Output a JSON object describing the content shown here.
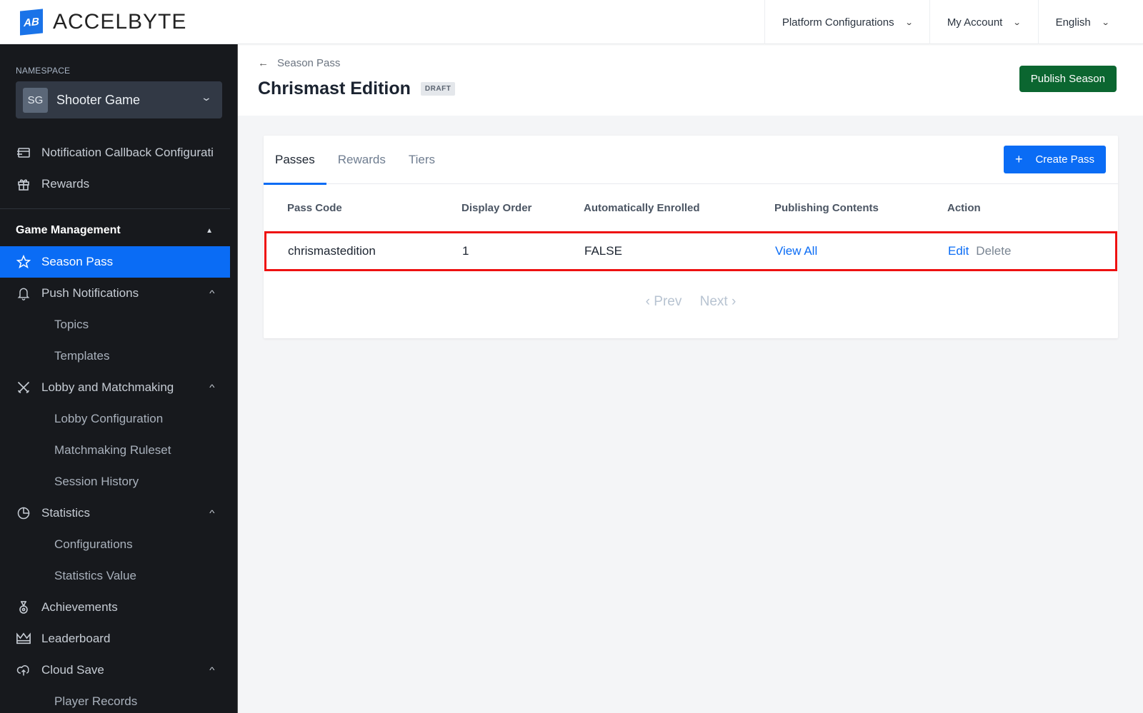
{
  "app": {
    "logo_mark": "AB",
    "logo_text": "ACCELBYTE"
  },
  "topbar": {
    "menus": [
      {
        "label": "Platform Configurations"
      },
      {
        "label": "My Account"
      },
      {
        "label": "English"
      }
    ]
  },
  "sidebar": {
    "namespace_label": "NAMESPACE",
    "namespace_avatar": "SG",
    "namespace_name": "Shooter Game",
    "items_top": [
      {
        "label": "Notification Callback Configurati",
        "icon": "callback-icon"
      },
      {
        "label": "Rewards",
        "icon": "gift-icon"
      }
    ],
    "group_label": "Game Management",
    "items": [
      {
        "label": "Season Pass",
        "icon": "star-icon",
        "active": true
      },
      {
        "label": "Push Notifications",
        "icon": "bell-icon",
        "expanded": true
      },
      {
        "label": "Topics",
        "sub": true
      },
      {
        "label": "Templates",
        "sub": true
      },
      {
        "label": "Lobby and Matchmaking",
        "icon": "swords-icon",
        "expanded": true
      },
      {
        "label": "Lobby Configuration",
        "sub": true
      },
      {
        "label": "Matchmaking Ruleset",
        "sub": true
      },
      {
        "label": "Session History",
        "sub": true
      },
      {
        "label": "Statistics",
        "icon": "pie-chart-icon",
        "expanded": true
      },
      {
        "label": "Configurations",
        "sub": true
      },
      {
        "label": "Statistics Value",
        "sub": true
      },
      {
        "label": "Achievements",
        "icon": "medal-icon"
      },
      {
        "label": "Leaderboard",
        "icon": "crown-icon"
      },
      {
        "label": "Cloud Save",
        "icon": "cloud-upload-icon",
        "expanded": true
      },
      {
        "label": "Player Records",
        "sub": true
      }
    ]
  },
  "page": {
    "breadcrumb_back": "Season Pass",
    "title": "Chrismast Edition",
    "status_badge": "DRAFT",
    "publish_button": "Publish Season"
  },
  "tabs": [
    {
      "label": "Passes",
      "active": true
    },
    {
      "label": "Rewards"
    },
    {
      "label": "Tiers"
    }
  ],
  "create_button": "Create Pass",
  "table": {
    "columns": [
      "Pass Code",
      "Display Order",
      "Automatically Enrolled",
      "Publishing Contents",
      "Action"
    ],
    "rows": [
      {
        "pass_code": "chrismastedition",
        "display_order": "1",
        "auto_enrolled": "FALSE",
        "publishing_contents": "View All",
        "actions": [
          "Edit",
          "Delete"
        ]
      }
    ]
  },
  "pagination": {
    "prev": "‹ Prev",
    "next": "Next ›"
  },
  "colors": {
    "accent": "#0a6cf5",
    "publish": "#0b6630",
    "highlight": "#ee1111",
    "sidebar_bg": "#17191d"
  }
}
